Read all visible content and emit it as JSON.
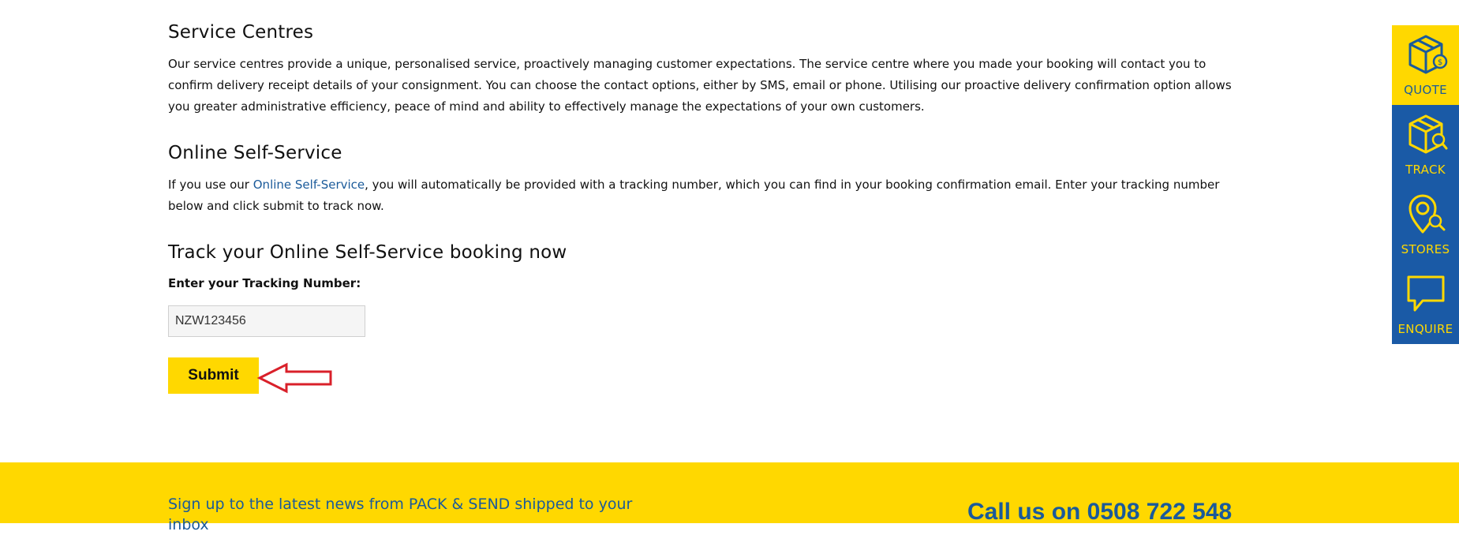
{
  "service_centres": {
    "heading": "Service Centres",
    "body": "Our service centres provide a unique, personalised service, proactively managing customer expectations. The service centre where you made your booking will contact you to confirm delivery receipt details of your consignment. You can choose the contact options, either by SMS, email or phone. Utilising our proactive delivery confirmation option allows you greater administrative efficiency, peace of mind and ability to effectively manage the expectations of your own customers."
  },
  "online_self_service": {
    "heading": "Online Self-Service",
    "body_before": "If you use our ",
    "link": "Online Self-Service",
    "body_after": ", you will automatically be provided with a tracking number, which you can find in your booking confirmation email. Enter your tracking number below and click submit to track now."
  },
  "track": {
    "heading": "Track your Online Self-Service booking now",
    "label": "Enter your Tracking Number:",
    "input_value": "NZW123456",
    "submit_label": "Submit"
  },
  "footer": {
    "newsletter": "Sign up to the latest news from PACK & SEND shipped to your inbox",
    "call": "Call us on 0508 722 548"
  },
  "sidebar": {
    "items": [
      {
        "label": "QUOTE",
        "icon": "box-quote-icon"
      },
      {
        "label": "TRACK",
        "icon": "box-search-icon"
      },
      {
        "label": "STORES",
        "icon": "location-search-icon"
      },
      {
        "label": "ENQUIRE",
        "icon": "chat-bubble-icon"
      }
    ]
  },
  "colors": {
    "brand_yellow": "#ffd800",
    "brand_blue": "#1a5aa6",
    "annotation_arrow": "#d9202a"
  }
}
